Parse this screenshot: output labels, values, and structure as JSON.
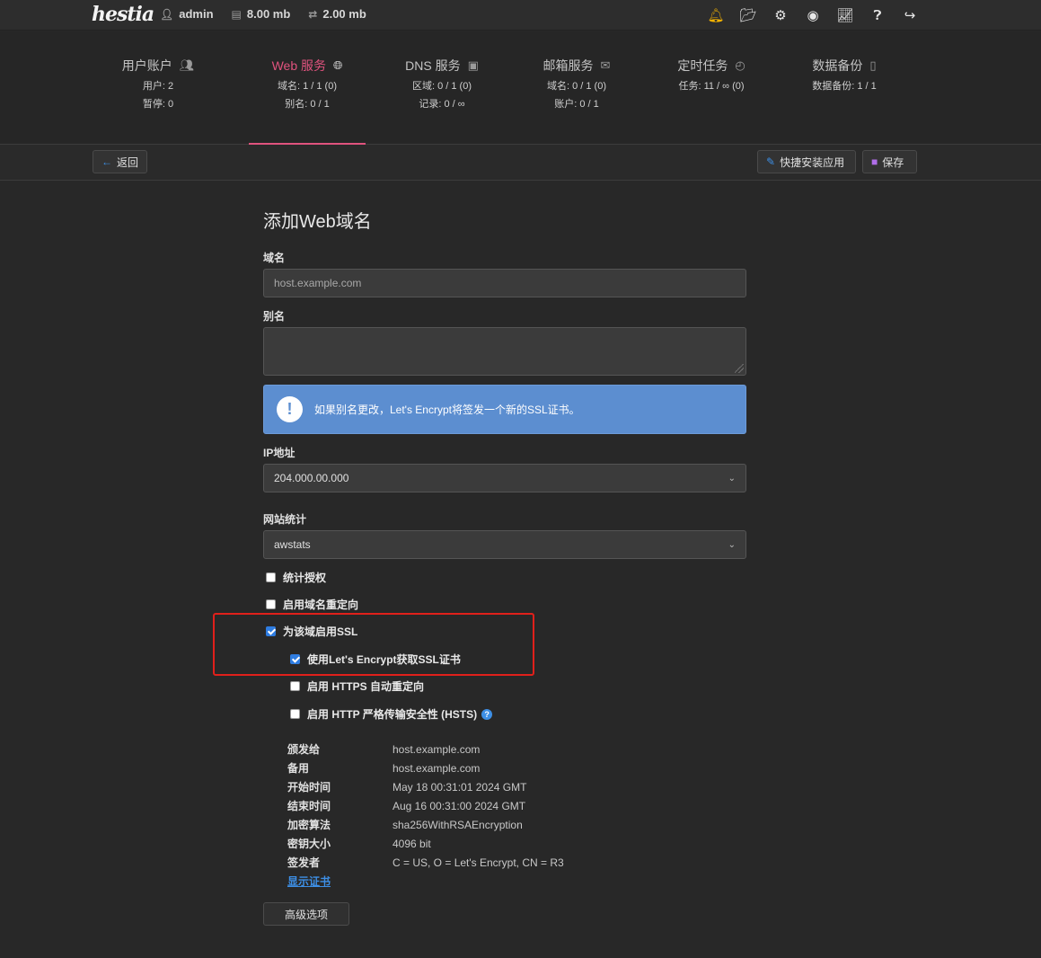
{
  "topbar": {
    "logo": "hestia",
    "user": "admin",
    "disk": "8.00 mb",
    "bandwidth": "2.00 mb",
    "icons": [
      "bell-icon",
      "folder-icon",
      "gear-icon",
      "user-icon",
      "chart-icon",
      "help-icon",
      "logout-icon"
    ]
  },
  "nav": {
    "items": [
      {
        "label": "用户账户",
        "icon": "users-icon",
        "stat1": "用户: 2",
        "stat2": "暂停: 0"
      },
      {
        "label": "Web 服务",
        "icon": "globe-icon",
        "stat1": "域名: 1 / 1 (0)",
        "stat2": "别名: 0 / 1"
      },
      {
        "label": "DNS 服务",
        "icon": "book-icon",
        "stat1": "区域: 0 / 1 (0)",
        "stat2": "记录: 0 / ∞"
      },
      {
        "label": "邮箱服务",
        "icon": "mail-icon",
        "stat1": "域名: 0 / 1 (0)",
        "stat2": "账户: 0 / 1"
      },
      {
        "label": "定时任务",
        "icon": "clock-icon",
        "stat1": "任务: 11 / ∞ (0)",
        "stat2": ""
      },
      {
        "label": "数据备份",
        "icon": "file-icon",
        "stat1": "数据备份: 1 / 1",
        "stat2": ""
      }
    ],
    "active": "Web 服务"
  },
  "toolbar": {
    "back": "返回",
    "quick_install": "快捷安装应用",
    "save": "保存"
  },
  "form": {
    "title": "添加Web域名",
    "domain_label": "域名",
    "domain_placeholder": "host.example.com",
    "alias_label": "别名",
    "alert_text": "如果别名更改，Let's Encrypt将签发一个新的SSL证书。",
    "ip_label": "IP地址",
    "ip_value": "204.000.00.000",
    "stats_label": "网站统计",
    "stats_value": "awstats",
    "cb_stats_auth": "统计授权",
    "cb_redirect": "启用域名重定向",
    "cb_ssl": "为该域启用SSL",
    "cb_letsencrypt": "使用Let's Encrypt获取SSL证书",
    "cb_https_redirect": "启用 HTTPS 自动重定向",
    "cb_hsts": "启用 HTTP 严格传输安全性 (HSTS)",
    "checked": {
      "stats_auth": false,
      "redirect": false,
      "ssl": true,
      "letsencrypt": true,
      "https_redirect": false,
      "hsts": false
    }
  },
  "cert": {
    "rows": [
      {
        "k": "颁发给",
        "v": "host.example.com"
      },
      {
        "k": "备用",
        "v": "host.example.com"
      },
      {
        "k": "开始时间",
        "v": "May 18 00:31:01 2024 GMT"
      },
      {
        "k": "结束时间",
        "v": "Aug 16 00:31:00 2024 GMT"
      },
      {
        "k": "加密算法",
        "v": "sha256WithRSAEncryption"
      },
      {
        "k": "密钥大小",
        "v": "4096 bit"
      },
      {
        "k": "签发者",
        "v": "C = US, O = Let's Encrypt, CN = R3"
      }
    ],
    "show_cert": "显示证书"
  },
  "advanced": "高级选项",
  "colors": {
    "accent": "#e0537e",
    "link": "#3d8fe6",
    "alert": "#5c8ed0",
    "highlight": "#e0201b"
  }
}
